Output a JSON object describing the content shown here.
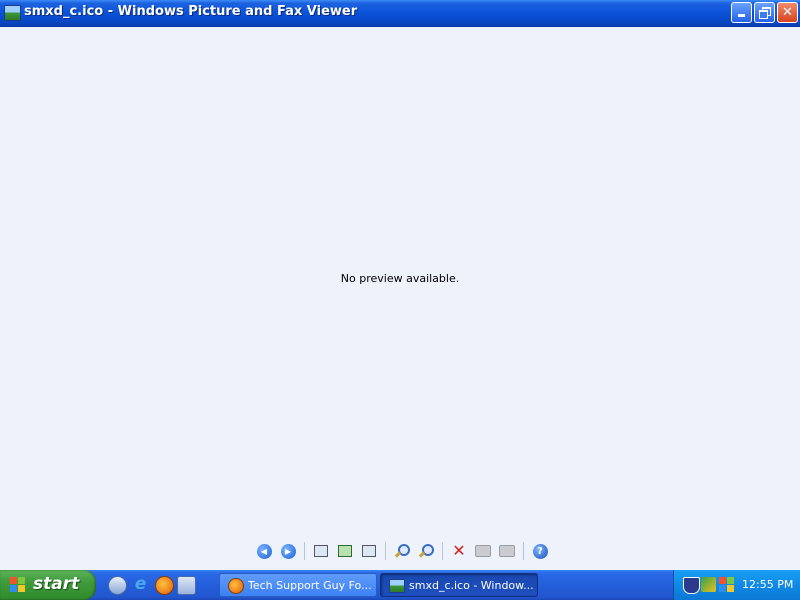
{
  "window": {
    "title": "smxd_c.ico - Windows Picture and Fax Viewer"
  },
  "viewer": {
    "message": "No preview available."
  },
  "toolbar": {
    "buttons": [
      {
        "name": "previous-image",
        "icon": "prev-icon"
      },
      {
        "name": "next-image",
        "icon": "next-icon"
      },
      {
        "name": "best-fit",
        "icon": "best-fit-icon"
      },
      {
        "name": "actual-size",
        "icon": "actual-size-icon"
      },
      {
        "name": "slide-show",
        "icon": "slideshow-icon"
      },
      {
        "name": "zoom-in",
        "icon": "zoom-in-icon"
      },
      {
        "name": "zoom-out",
        "icon": "zoom-out-icon"
      },
      {
        "name": "delete",
        "icon": "delete-icon"
      },
      {
        "name": "print",
        "icon": "print-icon"
      },
      {
        "name": "copy-to",
        "icon": "copy-to-icon"
      },
      {
        "name": "help",
        "icon": "help-icon"
      }
    ]
  },
  "taskbar": {
    "start_label": "start",
    "tasks": [
      {
        "label": "Tech Support Guy Fo..."
      },
      {
        "label": "smxd_c.ico - Window..."
      }
    ],
    "clock": "12:55 PM"
  }
}
